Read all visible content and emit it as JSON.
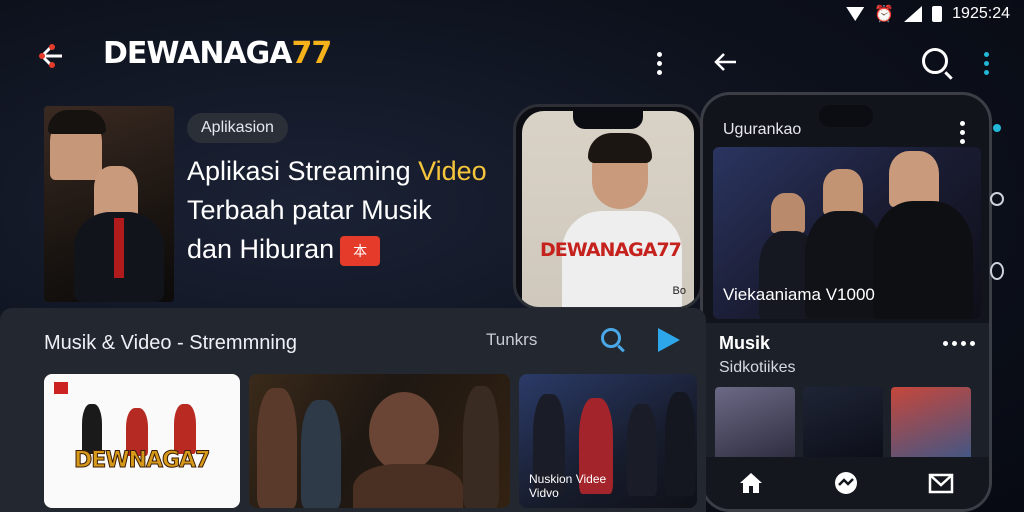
{
  "status_bar": {
    "time": "1925:24"
  },
  "header": {
    "brand_main": "DEWANAGA",
    "brand_accent": "77"
  },
  "hero": {
    "pill": "Aplikasion",
    "line1_pre": "Aplikasi Streaming ",
    "line1_hl": "Video",
    "line2": "Terbaah patar Musik",
    "line3": "dan Hiburan",
    "badge": "本"
  },
  "phone1": {
    "brand": "DEWANAGA77",
    "corner": "Bo"
  },
  "phone2": {
    "title": "Ugurankao",
    "hero_caption": "Viekaaniama V1000",
    "section_title": "Musik",
    "section_sub": "Sidkotiikes"
  },
  "panel": {
    "title": "Musik & Video - Stremmning",
    "link": "Tunkrs",
    "card1_logo": "DEWNAGA7",
    "card3_caption_1": "Nuskion Videe",
    "card3_caption_2": "Vidvo"
  },
  "colors": {
    "accent_gold": "#f5b21a",
    "accent_blue": "#2ea7ea",
    "accent_red": "#e43b2b"
  }
}
